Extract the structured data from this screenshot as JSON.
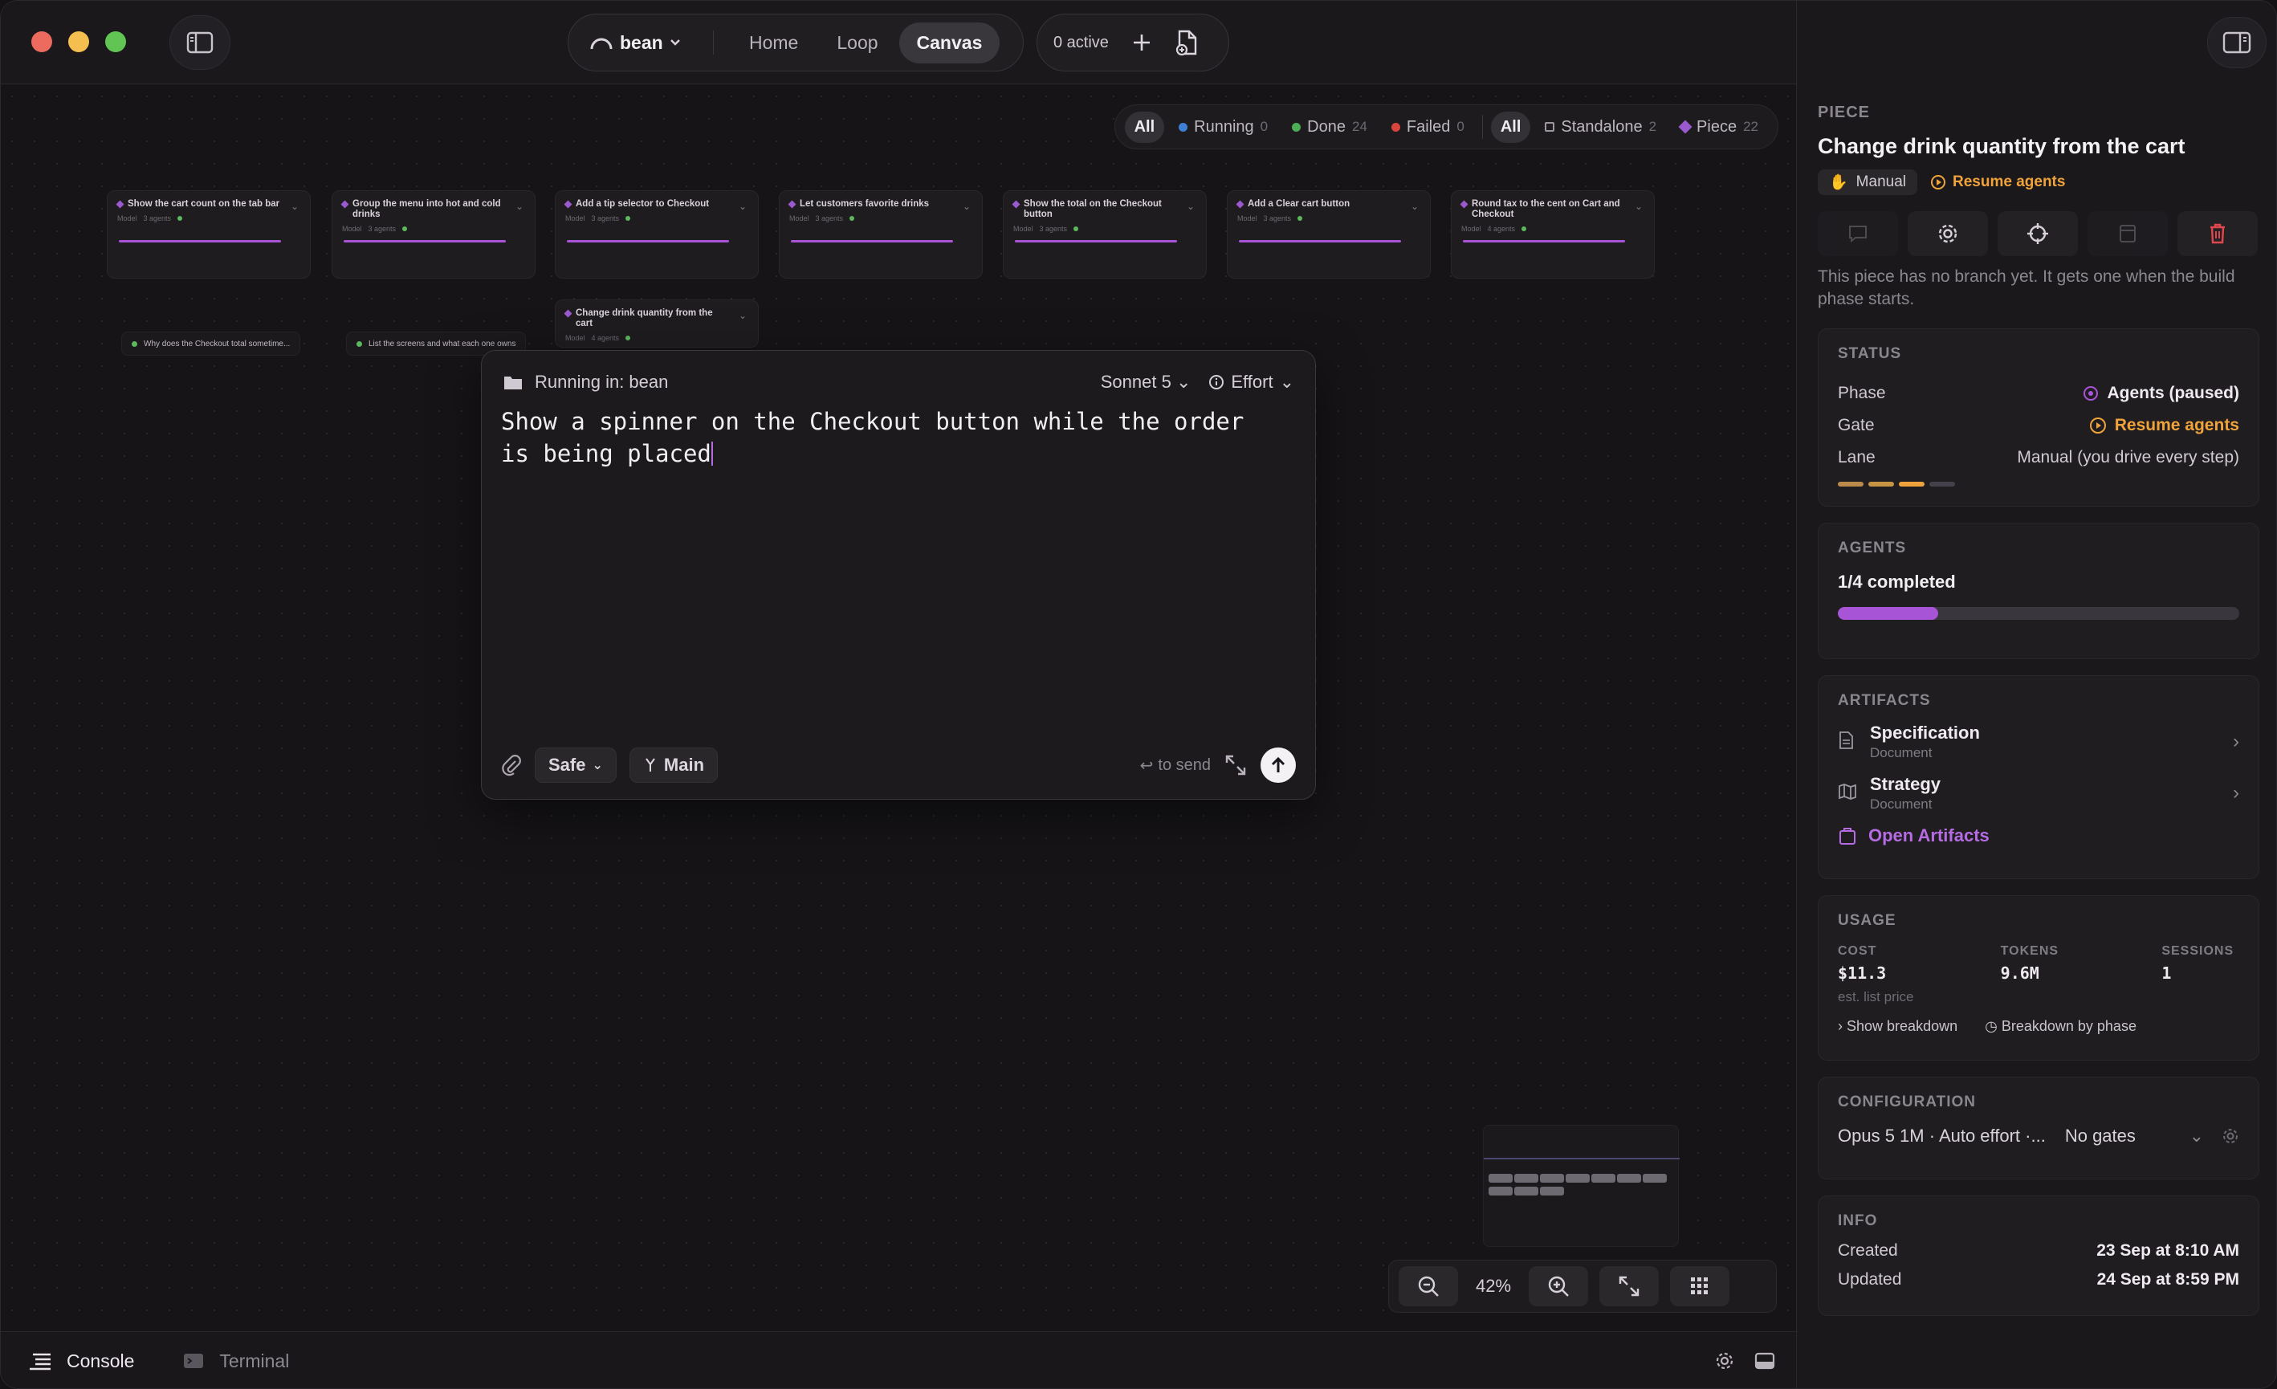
{
  "app": {
    "project": "bean",
    "nav": [
      "Home",
      "Loop",
      "Canvas"
    ],
    "active_nav": "Canvas",
    "active_count": "0 active"
  },
  "filters": [
    {
      "label": "All",
      "count": "",
      "kind": "all",
      "active": true
    },
    {
      "label": "Running",
      "count": "0",
      "kind": "dot",
      "color": "#3e7fd6"
    },
    {
      "label": "Done",
      "count": "24",
      "kind": "dot",
      "color": "#4cae55"
    },
    {
      "label": "Failed",
      "count": "0",
      "kind": "dot",
      "color": "#d9453c"
    },
    {
      "label": "All",
      "count": "",
      "kind": "all",
      "active": true
    },
    {
      "label": "Standalone",
      "count": "2",
      "kind": "square"
    },
    {
      "label": "Piece",
      "count": "22",
      "kind": "diamond"
    }
  ],
  "cards": [
    {
      "title": "Show the cart count on the tab bar",
      "meta": "3 agents"
    },
    {
      "title": "Group the menu into hot and cold drinks",
      "meta": "3 agents"
    },
    {
      "title": "Add a tip selector to Checkout",
      "meta": "3 agents"
    },
    {
      "title": "Let customers favorite drinks",
      "meta": "3 agents"
    },
    {
      "title": "Show the total on the Checkout button",
      "meta": "3 agents"
    },
    {
      "title": "Add a Clear cart button",
      "meta": "3 agents"
    },
    {
      "title": "Round tax to the cent on Cart and Checkout",
      "meta": "4 agents"
    },
    {
      "title": "Change drink quantity from the cart",
      "meta": "4 agents"
    }
  ],
  "standalone": [
    "Why does the Checkout total sometime...",
    "List the screens and what each one owns"
  ],
  "composer": {
    "running_in": "Running in: bean",
    "model": "Sonnet 5",
    "effort": "Effort",
    "prompt": "Show a spinner on the Checkout button while the order is being placed",
    "mode": "Safe",
    "branch": "Main",
    "send_hint": "to send"
  },
  "zoom": "42%",
  "bottom": {
    "console": "Console",
    "terminal": "Terminal"
  },
  "panel": {
    "label": "PIECE",
    "title": "Change drink quantity from the cart",
    "lane_tag": "Manual",
    "resume_tag": "Resume agents",
    "note": "This piece has no branch yet. It gets one when the build phase starts.",
    "status": {
      "heading": "STATUS",
      "phase_k": "Phase",
      "phase_v": "Agents (paused)",
      "gate_k": "Gate",
      "gate_v": "Resume agents",
      "lane_k": "Lane",
      "lane_v": "Manual (you drive every step)"
    },
    "agents": {
      "heading": "AGENTS",
      "summary": "1/4 completed",
      "progress": 0.25
    },
    "artifacts": {
      "heading": "ARTIFACTS",
      "items": [
        {
          "name": "Specification",
          "type": "Document"
        },
        {
          "name": "Strategy",
          "type": "Document"
        }
      ],
      "open": "Open Artifacts"
    },
    "usage": {
      "heading": "USAGE",
      "cost_k": "COST",
      "cost_v": "$11.3",
      "tokens_k": "TOKENS",
      "tokens_v": "9.6M",
      "sessions_k": "SESSIONS",
      "sessions_v": "1",
      "est": "est. list price",
      "show_breakdown": "Show breakdown",
      "by_phase": "Breakdown by phase"
    },
    "config": {
      "heading": "CONFIGURATION",
      "model": "Opus 5 1M · Auto effort ·...",
      "gates": "No gates"
    },
    "info": {
      "heading": "INFO",
      "created_k": "Created",
      "created_v": "23 Sep at 8:10 AM",
      "updated_k": "Updated",
      "updated_v": "24 Sep at 8:59 PM"
    }
  },
  "colors": {
    "accent": "#a854d6",
    "warning": "#f0a33a",
    "danger": "#e0474c"
  }
}
